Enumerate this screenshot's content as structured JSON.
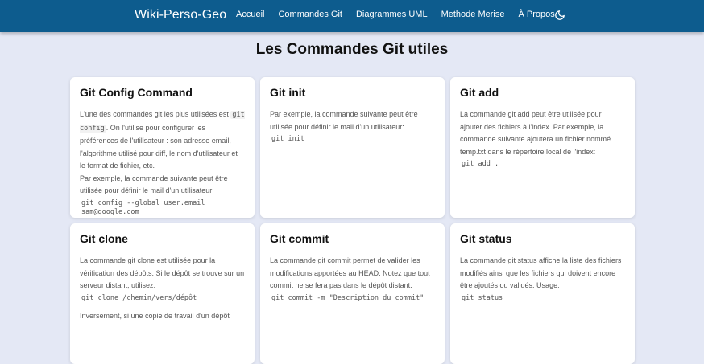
{
  "nav": {
    "brand": "Wiki-Perso-Geo",
    "links": [
      "Accueil",
      "Commandes Git",
      "Diagrammes UML",
      "Methode Merise",
      "À Propos"
    ]
  },
  "page_title": "Les Commandes Git utiles",
  "cards": [
    {
      "title": "Git Config Command",
      "p1_a": "L'une des commandes git les plus utilisées est",
      "p1_code": "git config",
      "p1_b": ". On l'utilise pour configurer les préférences de l'utilisateur : son adresse email, l'algorithme utilisé pour diff, le nom d'utilisateur et le format de fichier, etc.",
      "p2": "Par exemple, la commande suivante peut être utilisée pour définir le mail d'un utilisateur:",
      "code": "git config --global user.email sam@google.com"
    },
    {
      "title": "Git init",
      "p1": "Par exemple, la commande suivante peut être utilisée pour définir le mail d'un utilisateur:",
      "code": "git init"
    },
    {
      "title": "Git add",
      "p1": "La commande git add peut être utilisée pour ajouter des fichiers à l'index. Par exemple, la commande suivante ajoutera un fichier nommé temp.txt dans le répertoire local de l'index:",
      "code": "git add .",
      "code_suffix": ""
    },
    {
      "title": "Git clone",
      "p1": "La commande git clone est utilisée pour la vérification des dépôts. Si le dépôt se trouve sur un serveur distant, utilisez:",
      "code": "git clone /chemin/vers/dépôt",
      "p2": "Inversement, si une copie de travail d'un dépôt"
    },
    {
      "title": "Git commit",
      "p1": "La commande git commit permet de valider les modifications apportées au HEAD. Notez que tout commit ne se fera pas dans le dépôt distant.",
      "code": "git commit -m \"Description du commit\""
    },
    {
      "title": "Git status",
      "p1": "La commande git status affiche la liste des fichiers modifiés ainsi que les fichiers qui doivent encore être ajoutés ou validés. Usage:",
      "code": "git status"
    }
  ],
  "icons": {
    "theme": "moon-icon"
  },
  "colors": {
    "navbar": "#0d5c8e",
    "background": "#e4e8f5"
  }
}
